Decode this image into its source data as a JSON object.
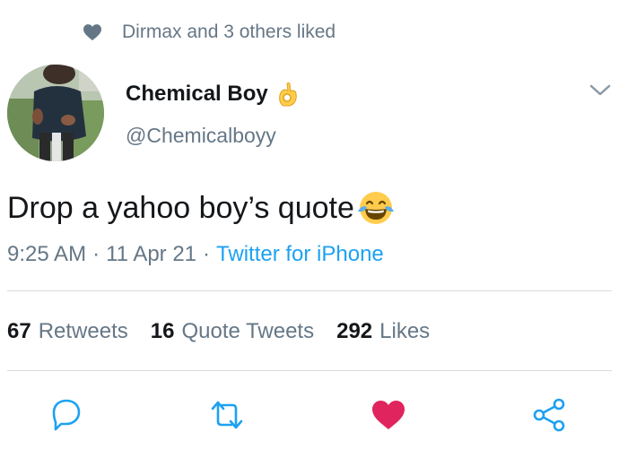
{
  "social_context": {
    "text": "Dirmax and 3 others liked",
    "icon": "heart-icon"
  },
  "author": {
    "name": "Chemical Boy",
    "name_emoji": "ok-hand-emoji",
    "handle": "@Chemicalboyy"
  },
  "tweet": {
    "text": "Drop a yahoo boy’s quote",
    "emoji": "face-with-tears-of-joy-emoji",
    "time": "9:25 AM",
    "date": "11 Apr 21",
    "source": "Twitter for iPhone"
  },
  "stats": {
    "retweets_count": "67",
    "retweets_label": "Retweets",
    "quotes_count": "16",
    "quotes_label": "Quote Tweets",
    "likes_count": "292",
    "likes_label": "Likes"
  },
  "actions": [
    "reply-icon",
    "retweet-icon",
    "like-icon",
    "share-icon"
  ],
  "colors": {
    "secondary_text": "#657786",
    "link": "#1da1f2",
    "like": "#e0245e",
    "divider": "#d6dce0"
  }
}
